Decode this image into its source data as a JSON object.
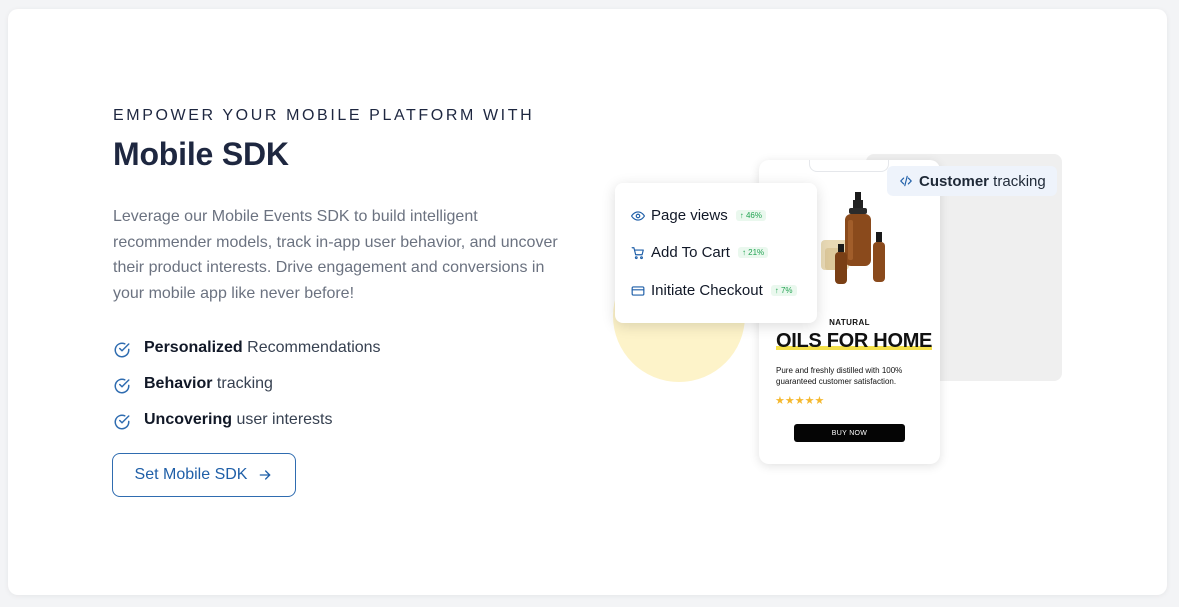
{
  "hero": {
    "eyebrow": "EMPOWER YOUR MOBILE PLATFORM WITH",
    "title": "Mobile SDK",
    "description": "Leverage our Mobile Events SDK to build intelligent recommender models, track in-app user behavior, and uncover their product interests. Drive engagement and conversions in your mobile app like never before!"
  },
  "features": [
    {
      "bold": "Personalized",
      "rest": " Recommendations"
    },
    {
      "bold": "Behavior",
      "rest": " tracking"
    },
    {
      "bold": "Uncovering",
      "rest": " user interests"
    }
  ],
  "cta": {
    "label": "Set Mobile SDK",
    "icon": "arrow-right-icon"
  },
  "tracking_chip": {
    "bold": "Customer",
    "rest": " tracking",
    "icon": "code-icon"
  },
  "metrics": [
    {
      "label": "Page views",
      "change": "↑ 46%",
      "icon": "eye-icon"
    },
    {
      "label": "Add To Cart",
      "change": "↑ 21%",
      "icon": "cart-icon"
    },
    {
      "label": "Initiate Checkout",
      "change": "↑ 7%",
      "icon": "credit-card-icon"
    }
  ],
  "product": {
    "kicker": "NATURAL",
    "headline": "OILS FOR HOME",
    "description": "Pure and freshly distilled with 100% guaranteed customer satisfaction.",
    "stars": "★★★★★",
    "rating_stars": 5,
    "buy_label": "BUY NOW"
  },
  "colors": {
    "primary": "#1f5fa8",
    "heading": "#1e2740",
    "accent_yellow": "#f4e04a",
    "positive": "#22a352"
  }
}
